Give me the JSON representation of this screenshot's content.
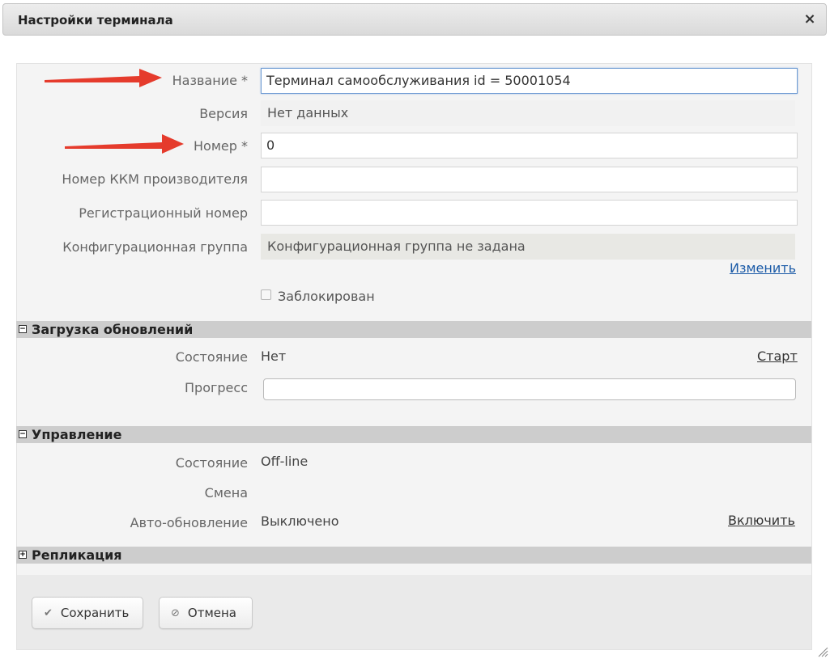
{
  "dialog": {
    "title": "Настройки терминала",
    "close_icon": "×"
  },
  "form": {
    "name": {
      "label": "Название *",
      "value": "Терминал самообслуживания id = 50001054"
    },
    "version": {
      "label": "Версия",
      "value": "Нет данных"
    },
    "number": {
      "label": "Номер *",
      "value": "0"
    },
    "kkm_number": {
      "label": "Номер ККМ производителя",
      "value": ""
    },
    "reg_number": {
      "label": "Регистрационный номер",
      "value": ""
    },
    "config_group": {
      "label": "Конфигурационная группа",
      "value": "Конфигурационная группа не задана",
      "change_link": "Изменить"
    },
    "blocked": {
      "label": "Заблокирован",
      "checked": false
    }
  },
  "updates": {
    "title": "Загрузка обновлений",
    "toggle": "−",
    "state_label": "Состояние",
    "state_value": "Нет",
    "start_link": "Старт",
    "progress_label": "Прогресс",
    "progress_percent": 0
  },
  "management": {
    "title": "Управление",
    "toggle": "−",
    "state_label": "Состояние",
    "state_value": "Off-line",
    "shift_label": "Смена",
    "auto_update_label": "Авто-обновление",
    "auto_update_value": "Выключено",
    "enable_link": "Включить"
  },
  "replication": {
    "title": "Репликация",
    "toggle": "+"
  },
  "buttons": {
    "save": "Сохранить",
    "cancel": "Отмена",
    "save_icon": "✔",
    "cancel_icon": "⊘"
  },
  "colors": {
    "annotation_arrow": "#e53b2c",
    "link_blue": "#1a5aa7",
    "section_bar": "#cdcdcd"
  }
}
